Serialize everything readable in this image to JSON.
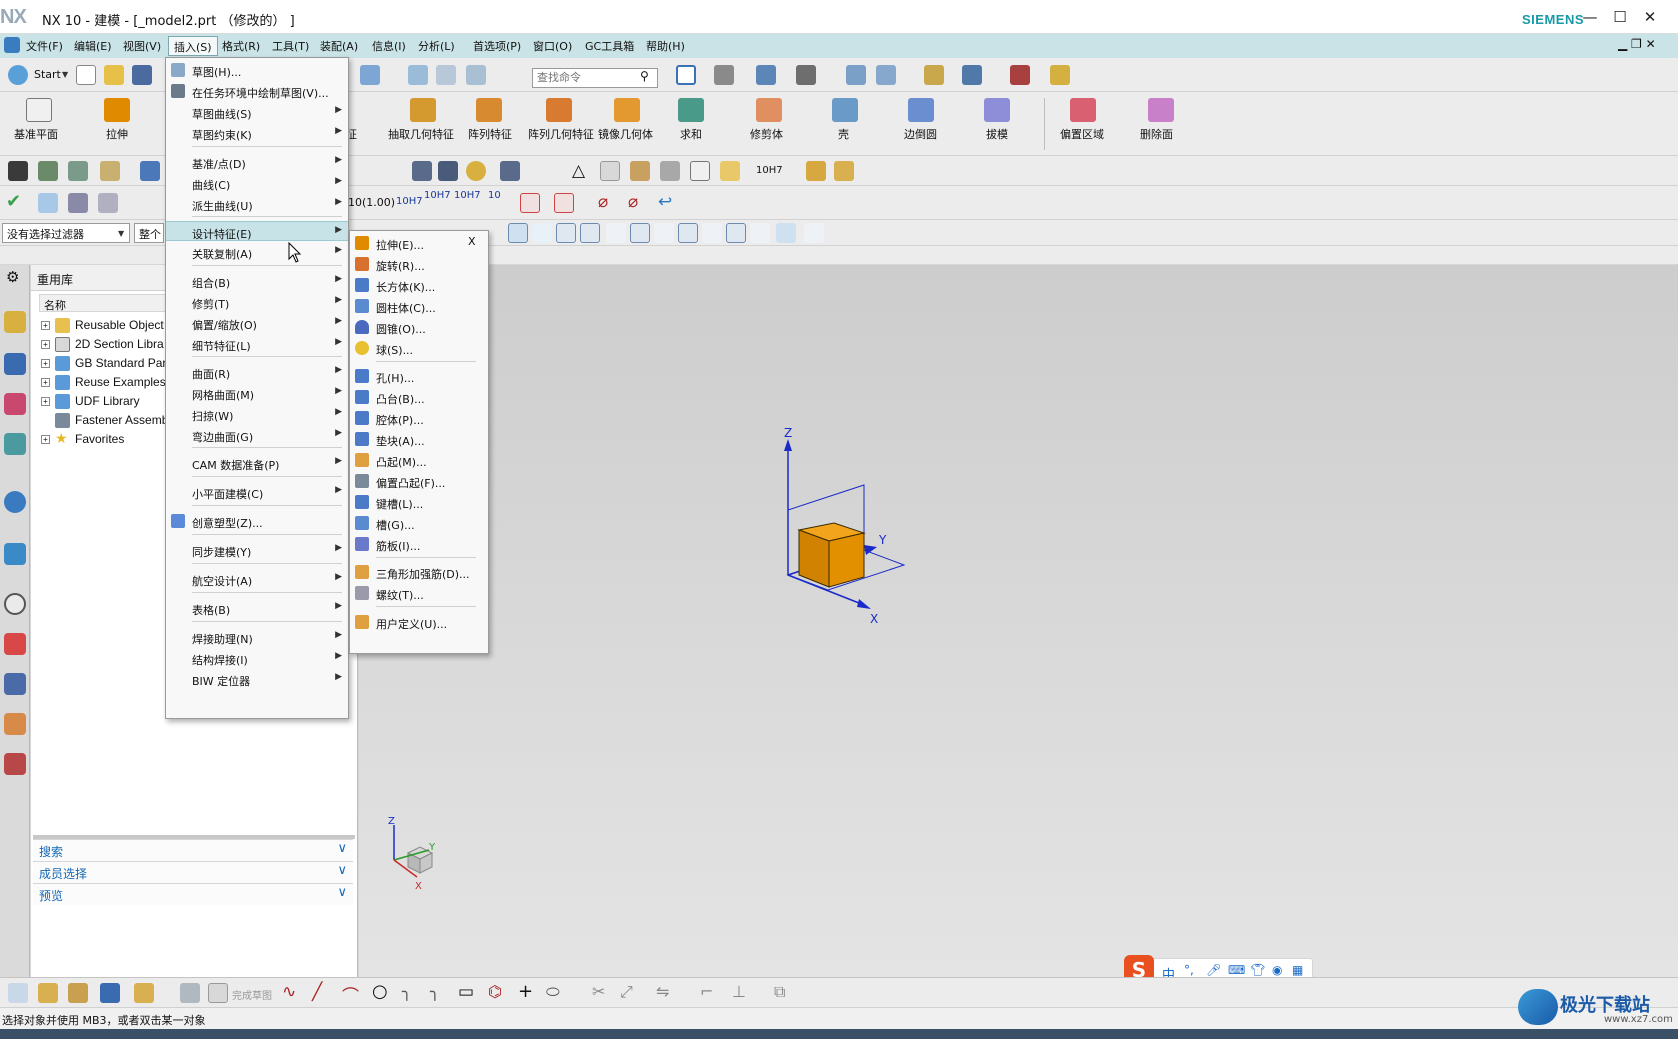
{
  "window": {
    "logo": "NX",
    "title": "NX 10 - 建模 - [_model2.prt （修改的） ]",
    "brand": "SIEMENS",
    "controls": [
      "—",
      "☐",
      "✕"
    ]
  },
  "menubar": {
    "items": [
      "文件(F)",
      "编辑(E)",
      "视图(V)",
      "插入(S)",
      "格式(R)",
      "工具(T)",
      "装配(A)",
      "信息(I)",
      "分析(L)",
      "首选项(P)",
      "窗口(O)",
      "GC工具箱",
      "帮助(H)"
    ],
    "active": "插入(S)"
  },
  "toolbar": {
    "start_label": "Start",
    "search_placeholder": "查找命令",
    "big_buttons": [
      "基准平面",
      "拉伸",
      "征",
      "抽取几何特征",
      "阵列特征",
      "阵列几何特征",
      "镜像几何体",
      "求和",
      "修剪体",
      "壳",
      "边倒圆",
      "拔模",
      "偏置区域",
      "删除面"
    ],
    "tolerance_labels": [
      "10",
      "(1.00)",
      "10H7",
      "10H7",
      "10H7",
      "10",
      "10H7"
    ],
    "filter_combo": "没有选择过滤器",
    "scope_combo": "整个"
  },
  "navigator": {
    "title": "重用库",
    "column": "名称",
    "items": [
      "Reusable Object",
      "2D Section Libra",
      "GB Standard Par",
      "Reuse Examples",
      "UDF Library",
      "Fastener Assemb",
      "Favorites"
    ],
    "panels": [
      "搜索",
      "成员选择",
      "预览"
    ]
  },
  "insert_menu": {
    "items": [
      "草图(H)...",
      "在任务环境中绘制草图(V)...",
      "草图曲线(S)",
      "草图约束(K)",
      "基准/点(D)",
      "曲线(C)",
      "派生曲线(U)",
      "设计特征(E)",
      "关联复制(A)",
      "组合(B)",
      "修剪(T)",
      "偏置/缩放(O)",
      "细节特征(L)",
      "曲面(R)",
      "网格曲面(M)",
      "扫掠(W)",
      "弯边曲面(G)",
      "CAM 数据准备(P)",
      "小平面建模(C)",
      "创意塑型(Z)...",
      "同步建模(Y)",
      "航空设计(A)",
      "表格(B)",
      "焊接助理(N)",
      "结构焊接(I)",
      "BIW 定位器"
    ],
    "highlighted": "设计特征(E)"
  },
  "design_feature_menu": {
    "close": "X",
    "items": [
      "拉伸(E)...",
      "旋转(R)...",
      "长方体(K)...",
      "圆柱体(C)...",
      "圆锥(O)...",
      "球(S)...",
      "孔(H)...",
      "凸台(B)...",
      "腔体(P)...",
      "垫块(A)...",
      "凸起(M)...",
      "偏置凸起(F)...",
      "键槽(L)...",
      "槽(G)...",
      "筋板(I)...",
      "三角形加强筋(D)...",
      "螺纹(T)...",
      "用户定义(U)..."
    ]
  },
  "viewport": {
    "axis_labels": [
      "Z",
      "Y",
      "X"
    ],
    "triad_labels": [
      "Z",
      "Y",
      "X"
    ]
  },
  "bottom_toolbar": {
    "finish_sketch": "完成草图"
  },
  "status_bar": {
    "message": "选择对象并使用 MB3，或者双击某一对象"
  },
  "ime": {
    "label": "中"
  },
  "watermark": {
    "text": "极光下载站",
    "url": "www.xz7.com"
  },
  "colors": {
    "menubar": "#c9e3e6",
    "highlight": "#c8e3e8",
    "accent": "#1467b6",
    "siemens": "#179aa6",
    "block": "#e08a00"
  }
}
